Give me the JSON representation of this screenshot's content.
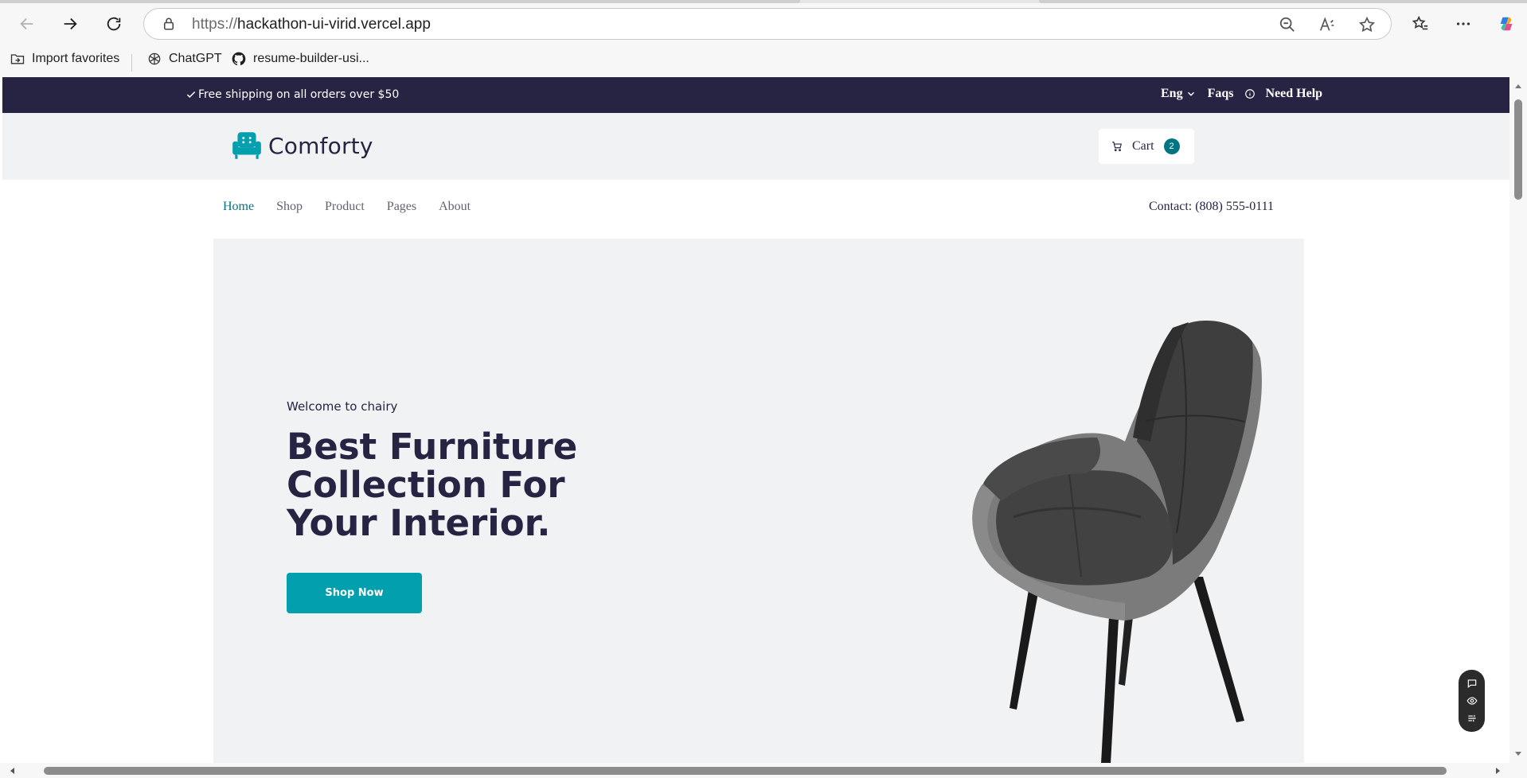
{
  "browser": {
    "url_protocol": "https://",
    "url_host": "hackathon-ui-virid.vercel.app",
    "bookmarks": [
      {
        "label": "Import favorites",
        "icon": "folder-import-icon"
      },
      {
        "label": "ChatGPT",
        "icon": "chatgpt-icon"
      },
      {
        "label": "resume-builder-usi...",
        "icon": "github-icon"
      }
    ]
  },
  "promo": {
    "text": "Free shipping on all orders over $50",
    "language": "Eng",
    "faqs": "Faqs",
    "help": "Need Help"
  },
  "header": {
    "logo_text": "Comforty",
    "cart_label": "Cart",
    "cart_count": "2"
  },
  "nav": {
    "links": [
      "Home",
      "Shop",
      "Product",
      "Pages",
      "About"
    ],
    "active": "Home",
    "contact": "Contact: (808) 555-0111"
  },
  "hero": {
    "subtitle": "Welcome to chairy",
    "title": "Best Furniture Collection For Your Interior.",
    "cta": "Shop Now"
  },
  "colors": {
    "promo_bg": "#272343",
    "header_bg": "#f0f2f3",
    "accent": "#029fae",
    "active_link": "#007580"
  }
}
